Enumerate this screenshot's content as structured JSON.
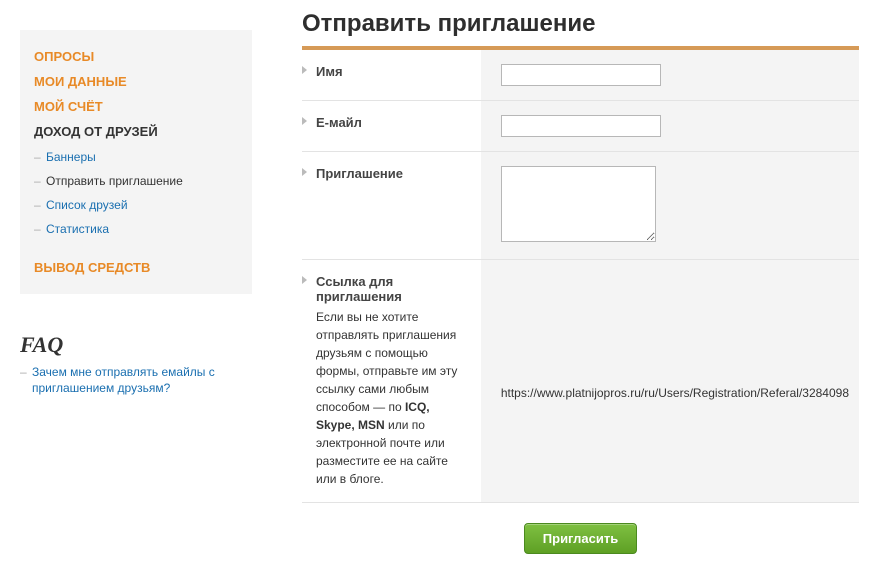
{
  "sidebar": {
    "nav": [
      {
        "label": "ОПРОСЫ"
      },
      {
        "label": "МОИ ДАННЫЕ"
      },
      {
        "label": "МОЙ СЧЁТ"
      },
      {
        "label": "ДОХОД ОТ ДРУЗЕЙ",
        "sub": [
          {
            "label": "Баннеры"
          },
          {
            "label": "Отправить приглашение"
          },
          {
            "label": "Список друзей"
          },
          {
            "label": "Статистика"
          }
        ]
      },
      {
        "label": "ВЫВОД СРЕДСТВ"
      }
    ]
  },
  "faq": {
    "title": "FAQ",
    "items": [
      "Зачем мне отправлять емайлы с приглашением друзьям?"
    ]
  },
  "page": {
    "title": "Отправить приглашение"
  },
  "form": {
    "name_label": "Имя",
    "email_label": "Е-майл",
    "invitation_label": "Приглашение",
    "reflink_heading": "Ссылка для приглашения",
    "reflink_desc_1": "Если вы не хотите отправлять приглашения друзьям с помощью формы, отправьте им эту ссылку сами любым способом — по ",
    "reflink_desc_bold": "ICQ, Skype, MSN",
    "reflink_desc_2": " или по электронной почте или разместите ее на сайте или в блоге.",
    "reflink_url": "https://www.platnijopros.ru/ru/Users/Registration/Referal/3284098",
    "submit_label": "Пригласить"
  }
}
